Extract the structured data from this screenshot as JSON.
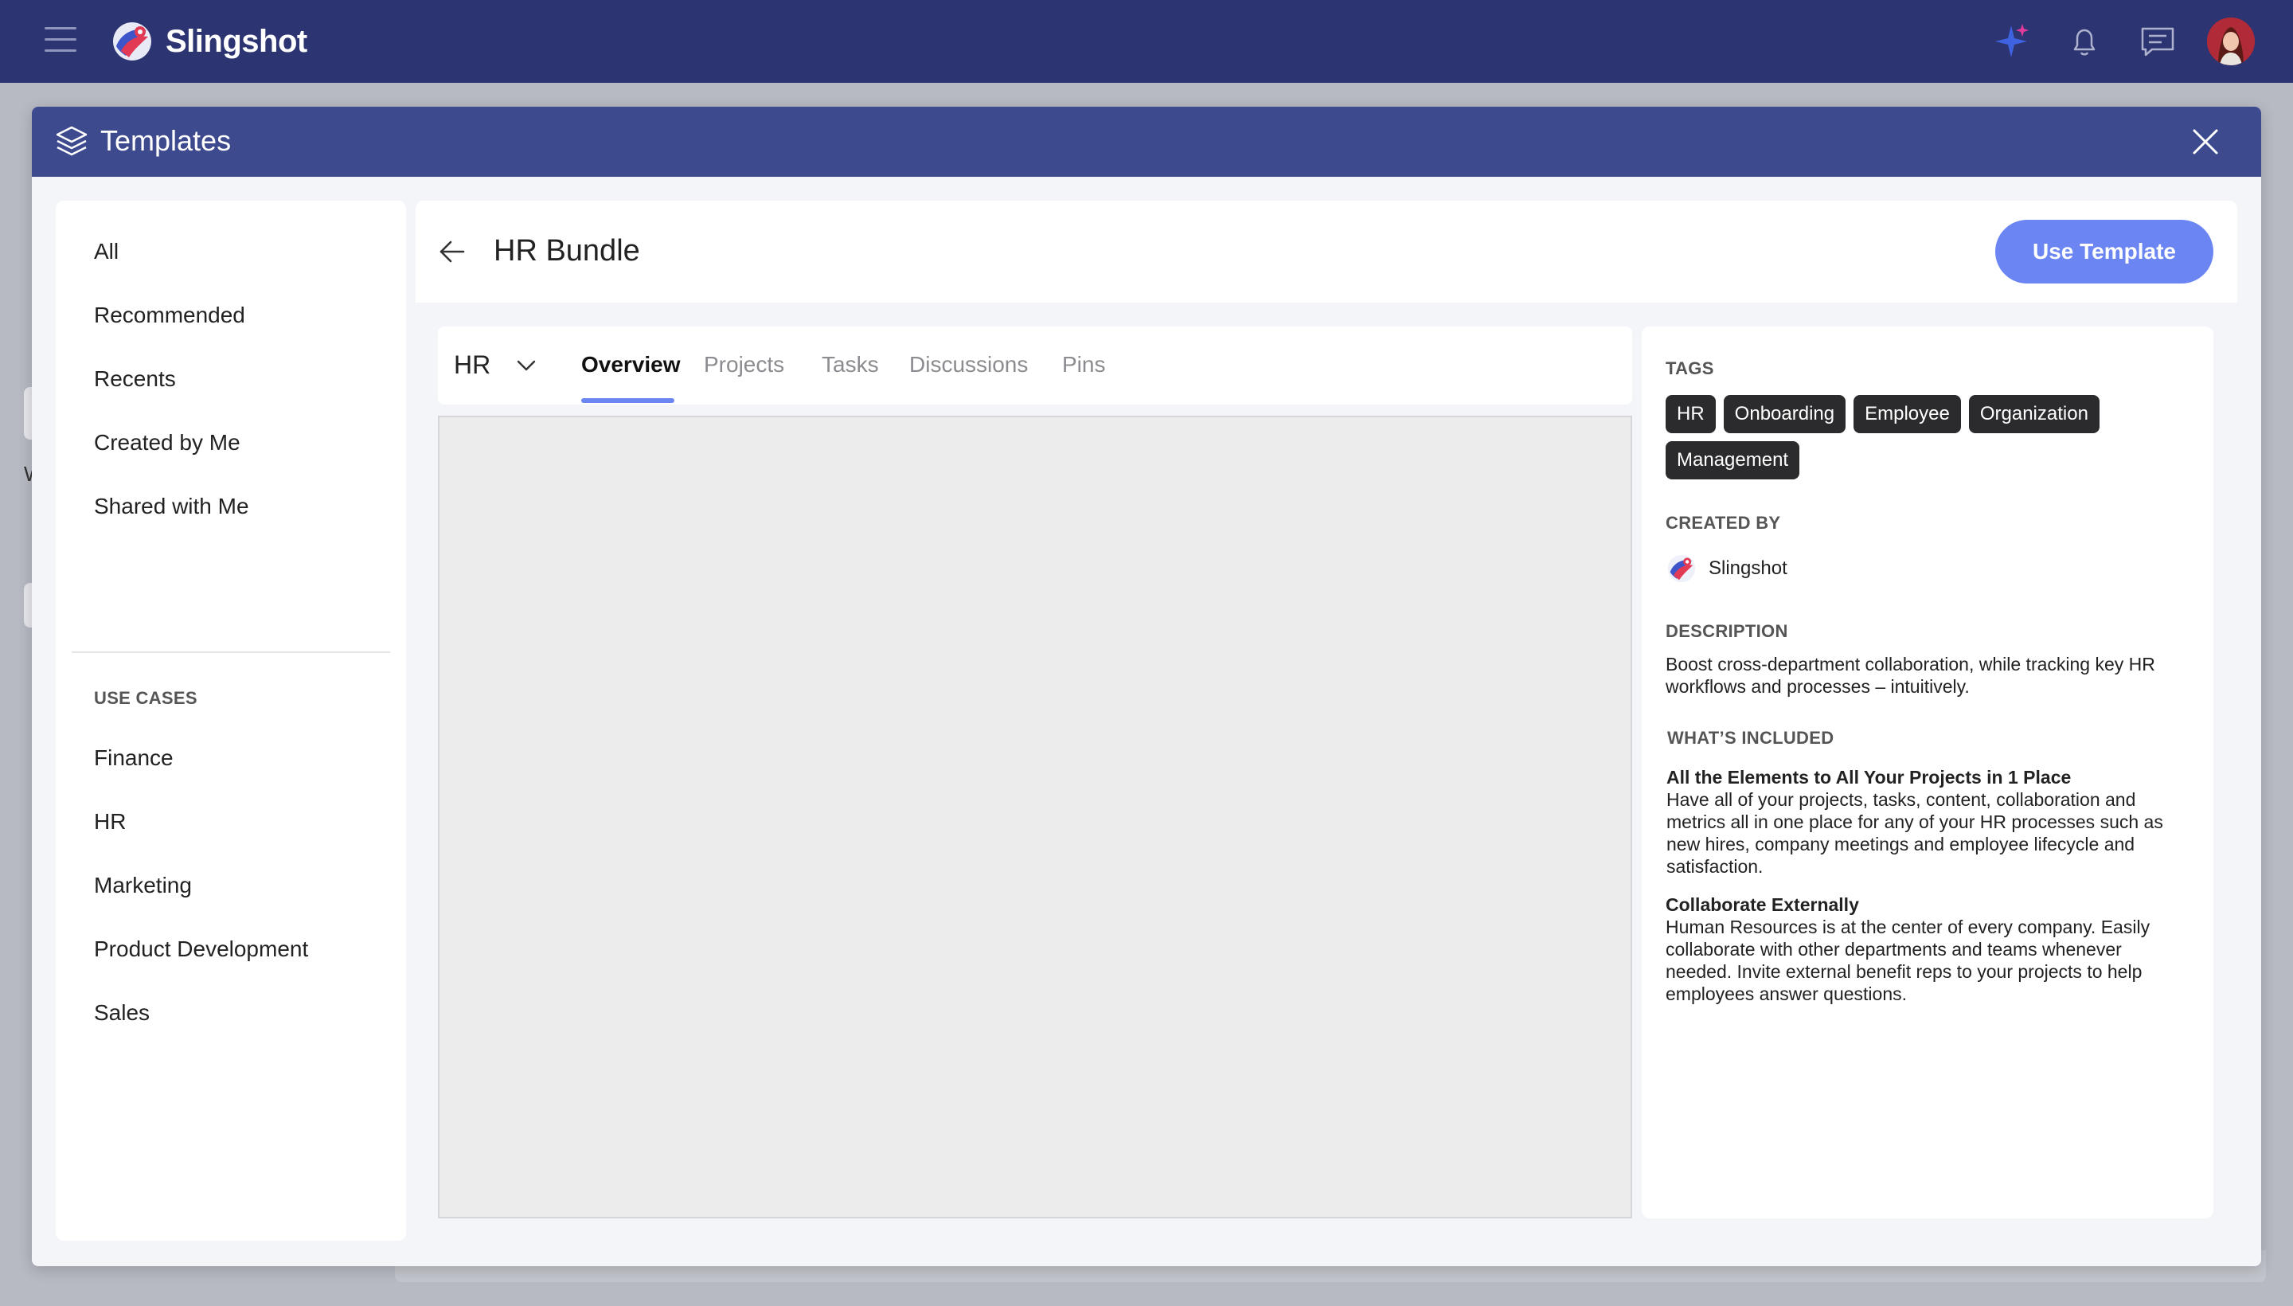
{
  "app": {
    "brand": "Slingshot",
    "icons": [
      "menu-icon",
      "sparkle-icon",
      "bell-icon",
      "chat-icon"
    ],
    "colors": {
      "topbar": "#2c3571",
      "modal_header": "#3e4a8e",
      "accent": "#6b86f2"
    }
  },
  "background": {
    "peek_letter": "W"
  },
  "modal": {
    "title": "Templates",
    "sidebar": {
      "items": [
        "All",
        "Recommended",
        "Recents",
        "Created by Me",
        "Shared with Me"
      ],
      "section_title": "USE CASES",
      "use_cases": [
        "Finance",
        "HR",
        "Marketing",
        "Product Development",
        "Sales"
      ]
    },
    "detail": {
      "title": "HR Bundle",
      "use_button": "Use Template",
      "project_select": "HR",
      "tabs": [
        "Overview",
        "Projects",
        "Tasks",
        "Discussions",
        "Pins"
      ],
      "active_tab": "Overview"
    },
    "info": {
      "tags_heading": "TAGS",
      "tags": [
        "HR",
        "Onboarding",
        "Employee",
        "Organization",
        "Management"
      ],
      "created_by_heading": "CREATED BY",
      "created_by": "Slingshot",
      "description_heading": "DESCRIPTION",
      "description": "Boost cross-department collaboration, while tracking key HR workflows and processes – intuitively.",
      "included_heading": "WHAT’S INCLUDED",
      "included": [
        {
          "title": "All the Elements to All Your Projects in 1 Place",
          "text": "Have all of your projects, tasks, content, collaboration and metrics all in one place for any of your HR processes such as new hires, company meetings and employee lifecycle and satisfaction."
        },
        {
          "title": "Collaborate Externally",
          "text": "Human Resources is at the center of every company. Easily collaborate with other departments and teams whenever needed. Invite external benefit reps to your projects to help employees answer questions."
        }
      ]
    }
  }
}
